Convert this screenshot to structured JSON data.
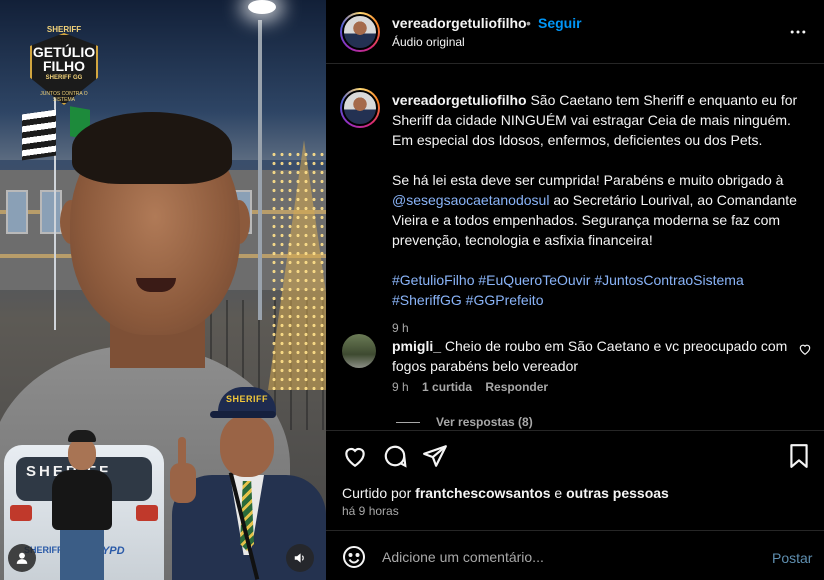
{
  "media": {
    "logo": {
      "top": "SHERIFF",
      "name": "GETÚLIO FILHO",
      "sub": "SHERIFF GG",
      "motto": "JUNTOS CONTRA O SISTEMA"
    },
    "car_text": "SHERIFF",
    "car_side": "SHERIFF",
    "car_nypd": "NYPD",
    "cap_text": "SHERIFF",
    "buttons": {
      "user_icon": "person-icon",
      "audio_icon": "speaker-icon"
    }
  },
  "post": {
    "username": "vereadorgetuliofilho",
    "separator": "•",
    "follow_label": "Seguir",
    "audio_label": "Áudio original",
    "more_icon": "ellipsis-icon",
    "caption": {
      "username": "vereadorgetuliofilho",
      "p1": "São Caetano tem Sheriff e enquanto eu for Sheriff da cidade NINGUÉM vai estragar Ceia de mais ninguém. Em especial dos Idosos, enfermos, deficientes ou dos Pets.",
      "p2_before": "Se há lei esta deve ser cumprida! Parabéns e muito obrigado à ",
      "p2_mention": "@sesegsaocaetanodosul",
      "p2_after": " ao Secretário Lourival, ao Comandante Vieira e a todos empenhados. Segurança moderna se faz com prevenção, tecnologia e asfixia financeira!",
      "hashtags": [
        "#GetulioFilho",
        "#EuQueroTeOuvir",
        "#JuntosContraoSistema",
        "#SheriffGG",
        "#GGPrefeito"
      ],
      "time": "9 h"
    },
    "comment": {
      "username": "pmigli_",
      "text": "Cheio de roubo em São Caetano e vc preocupado com fogos parabéns belo vereador",
      "time": "9 h",
      "likes": "1 curtida",
      "reply": "Responder",
      "view_replies": "Ver respostas (8)"
    },
    "likes_prefix": "Curtido por",
    "likes_user": "frantchescowsantos",
    "likes_and": "e",
    "likes_others": "outras pessoas",
    "time_ago": "há 9 horas",
    "comment_placeholder": "Adicione um comentário...",
    "post_label": "Postar"
  }
}
